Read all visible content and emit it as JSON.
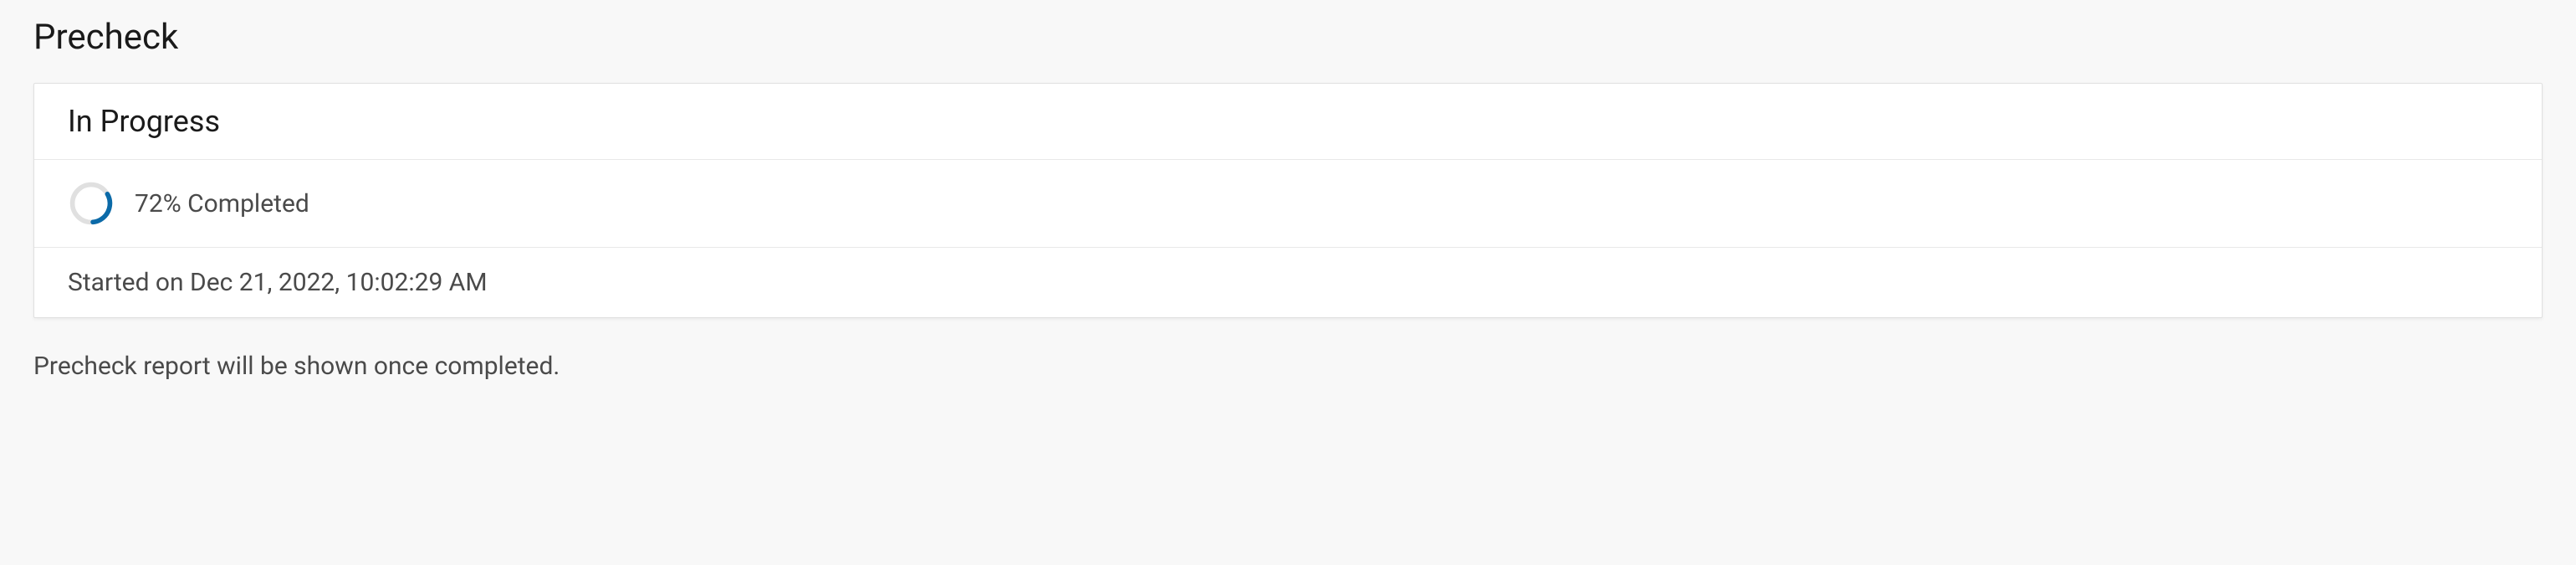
{
  "page": {
    "title": "Precheck"
  },
  "card": {
    "status_header": "In Progress",
    "progress_text": "72% Completed",
    "started_text": "Started on Dec 21, 2022, 10:02:29 AM"
  },
  "note": {
    "report_text": "Precheck report will be shown once completed."
  },
  "colors": {
    "spinner_track": "#e0e0e0",
    "spinner_arc": "#0b6aa8"
  }
}
